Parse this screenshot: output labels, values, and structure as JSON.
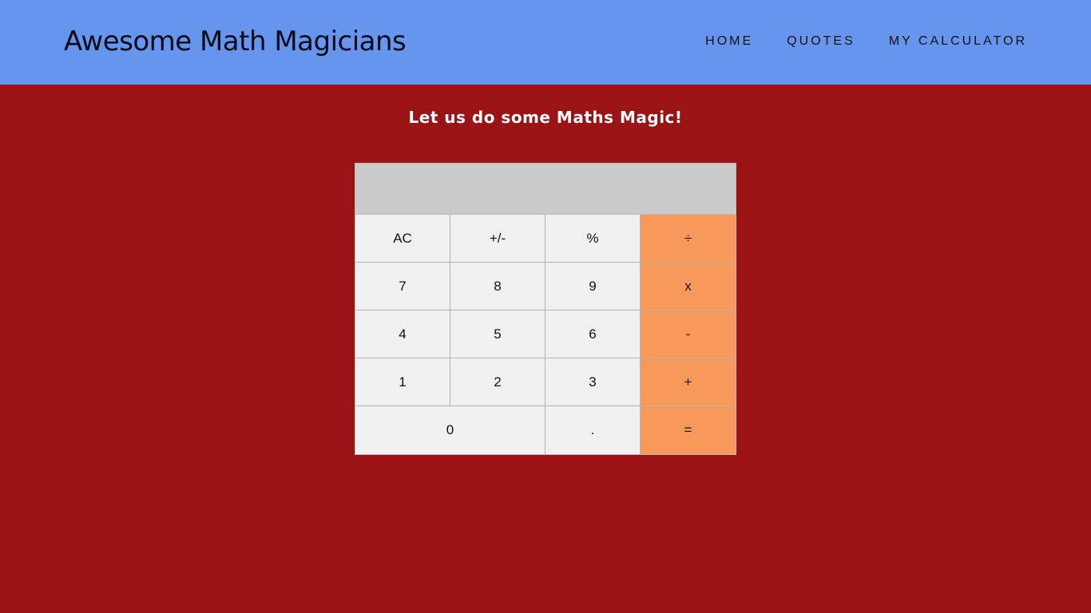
{
  "header": {
    "brand": "Awesome Math Magicians",
    "nav": [
      "HOME",
      "QUOTES",
      "MY CALCULATOR"
    ]
  },
  "main": {
    "tagline": "Let us do some Maths Magic!"
  },
  "calculator": {
    "display": "",
    "keys": {
      "ac": "AC",
      "sign": "+/-",
      "percent": "%",
      "divide": "÷",
      "seven": "7",
      "eight": "8",
      "nine": "9",
      "multiply": "x",
      "four": "4",
      "five": "5",
      "six": "6",
      "minus": "-",
      "one": "1",
      "two": "2",
      "three": "3",
      "plus": "+",
      "zero": "0",
      "dot": ".",
      "equals": "="
    }
  },
  "colors": {
    "header_bg": "#6595ec",
    "page_bg": "#9b1415",
    "display_bg": "#cbcbcb",
    "key_bg": "#f0f0f0",
    "operator_bg": "#f8995c"
  }
}
